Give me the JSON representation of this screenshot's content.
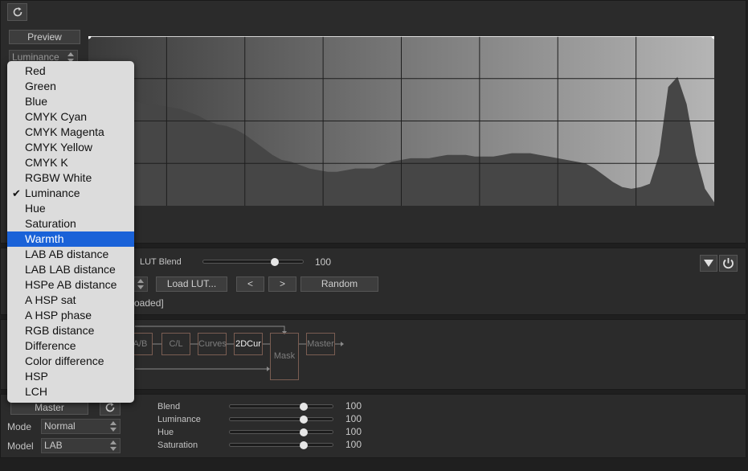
{
  "toolbar": {
    "refresh_icon": "refresh-icon"
  },
  "preview": {
    "label": "Preview"
  },
  "channel_select": {
    "value": "Luminance"
  },
  "histogram": {
    "grid_cols": 8,
    "grid_rows": 4,
    "profile": [
      0.73,
      0.72,
      0.68,
      0.66,
      0.63,
      0.62,
      0.6,
      0.6,
      0.59,
      0.58,
      0.57,
      0.55,
      0.53,
      0.5,
      0.48,
      0.47,
      0.45,
      0.42,
      0.38,
      0.34,
      0.3,
      0.27,
      0.26,
      0.24,
      0.22,
      0.21,
      0.2,
      0.2,
      0.21,
      0.22,
      0.22,
      0.22,
      0.24,
      0.26,
      0.27,
      0.28,
      0.28,
      0.28,
      0.29,
      0.3,
      0.3,
      0.3,
      0.29,
      0.29,
      0.29,
      0.3,
      0.31,
      0.31,
      0.31,
      0.3,
      0.29,
      0.28,
      0.27,
      0.26,
      0.25,
      0.22,
      0.18,
      0.14,
      0.11,
      0.1,
      0.11,
      0.13,
      0.3,
      0.7,
      0.76,
      0.6,
      0.3,
      0.1,
      0.02
    ]
  },
  "lut": {
    "blend_label": "LUT Blend",
    "blend_value": "100",
    "blend_fraction": 0.73,
    "load_label": "Load LUT...",
    "prev_label": "<",
    "next_label": ">",
    "random_label": "Random",
    "status_text": "oaded]"
  },
  "pipeline": {
    "nodes": [
      "A/B",
      "C/L",
      "Curves",
      "2DCur",
      "Mask",
      "Master"
    ]
  },
  "master": {
    "button_label": "Master",
    "mode_label": "Mode",
    "mode_value": "Normal",
    "model_label": "Model",
    "model_value": "LAB",
    "sliders": [
      {
        "label": "Blend",
        "value": "100",
        "fraction": 0.73
      },
      {
        "label": "Luminance",
        "value": "100",
        "fraction": 0.73
      },
      {
        "label": "Hue",
        "value": "100",
        "fraction": 0.73
      },
      {
        "label": "Saturation",
        "value": "100",
        "fraction": 0.73
      }
    ]
  },
  "menu": {
    "items": [
      "Red",
      "Green",
      "Blue",
      "CMYK Cyan",
      "CMYK Magenta",
      "CMYK Yellow",
      "CMYK K",
      "RGBW White",
      "Luminance",
      "Hue",
      "Saturation",
      "Warmth",
      "LAB AB distance",
      "LAB LAB distance",
      "HSPe AB distance",
      "A HSP sat",
      "A HSP phase",
      "RGB distance",
      "Difference",
      "Color difference",
      "HSP",
      "LCH"
    ],
    "checked": "Luminance",
    "highlighted": "Warmth"
  },
  "colors": {
    "menu_highlight": "#1a62d8",
    "node_border": "#7a5d52"
  }
}
